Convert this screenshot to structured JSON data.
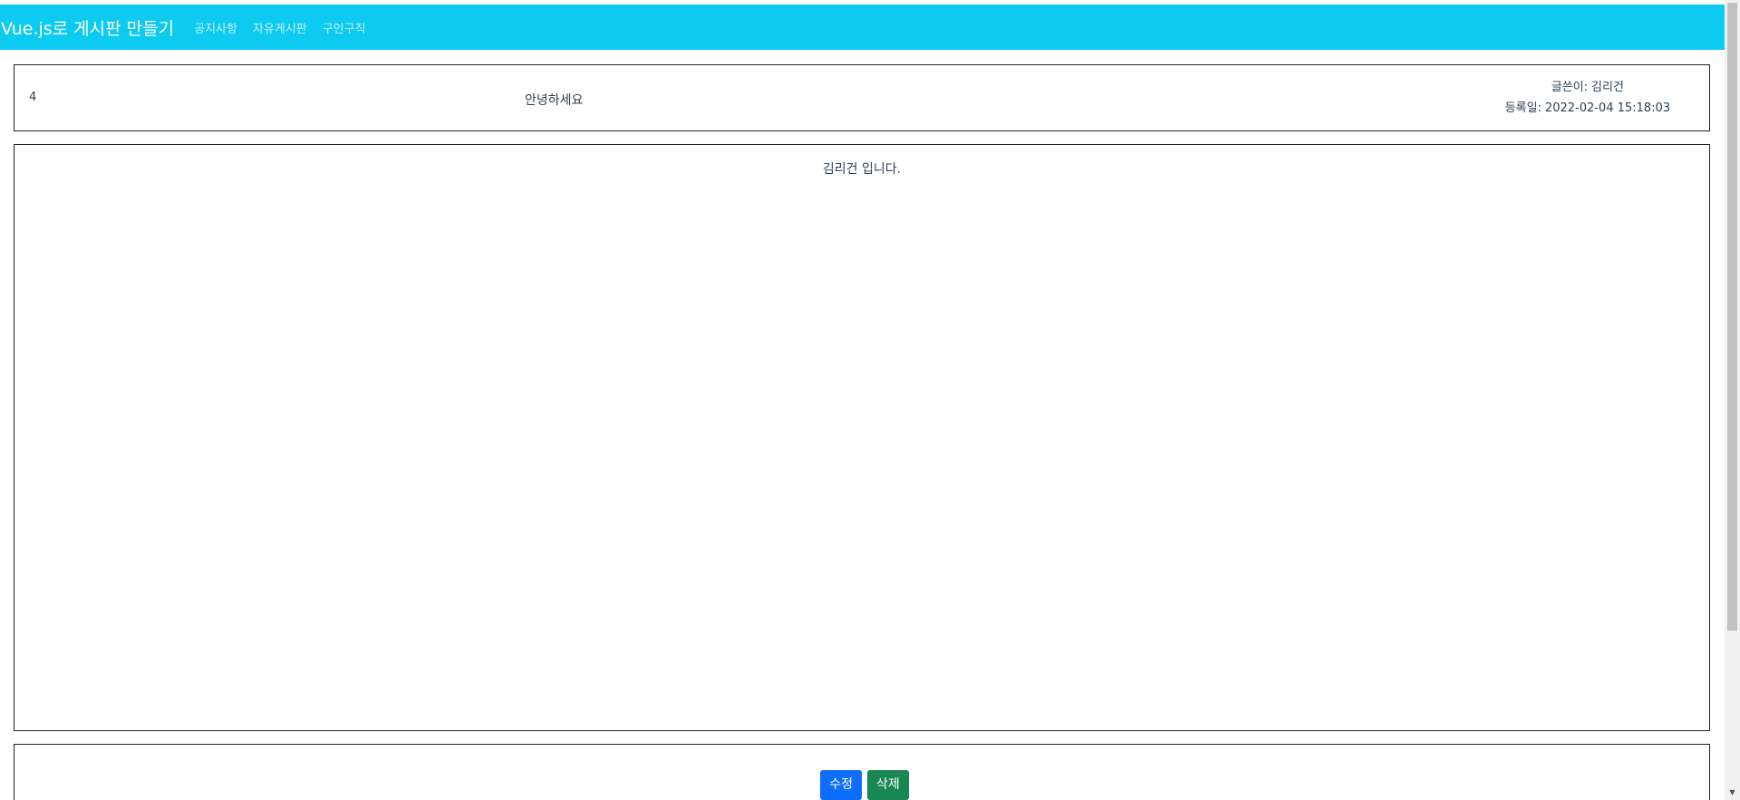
{
  "navbar": {
    "brand": "Vue.js로 게시판 만들기",
    "links": [
      "공지사항",
      "자유게시판",
      "구인구직"
    ],
    "color": "#0dcaf0"
  },
  "post": {
    "id": "4",
    "title": "안녕하세요",
    "author_label": "글쓴이:",
    "author": "김리건",
    "date_label": "등록일:",
    "date": "2022-02-04 15:18:03",
    "content": "김리건 입니다."
  },
  "actions": {
    "edit_label": "수정",
    "delete_label": "삭제",
    "edit_color": "#0d6efd",
    "delete_color": "#198754"
  },
  "icons": {
    "scroll_down": "chevron-down-icon"
  }
}
